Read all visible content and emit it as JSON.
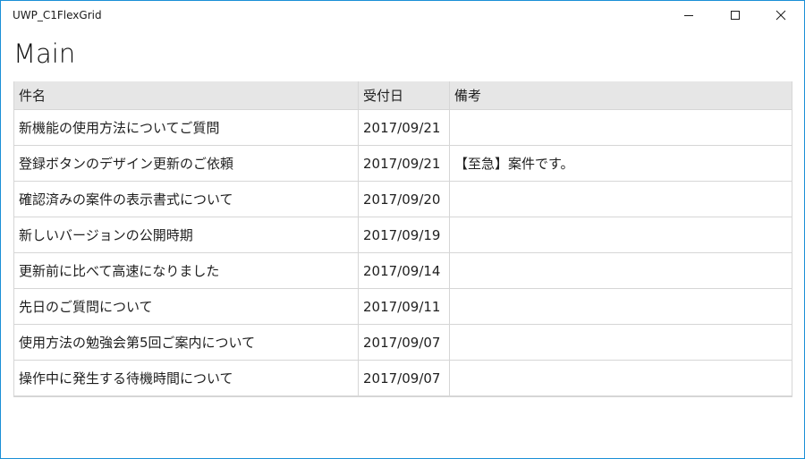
{
  "window": {
    "title": "UWP_C1FlexGrid",
    "accent": "#1a8fd6"
  },
  "caption_buttons": {
    "minimize_icon": "minimize-icon",
    "maximize_icon": "maximize-icon",
    "close_icon": "close-icon"
  },
  "page": {
    "title": "Main"
  },
  "grid": {
    "columns": [
      "件名",
      "受付日",
      "備考"
    ],
    "rows": [
      {
        "subject": "新機能の使用方法についてご質問",
        "date": "2017/09/21",
        "note": ""
      },
      {
        "subject": "登録ボタンのデザイン更新のご依頼",
        "date": "2017/09/21",
        "note": "【至急】案件です。"
      },
      {
        "subject": "確認済みの案件の表示書式について",
        "date": "2017/09/20",
        "note": ""
      },
      {
        "subject": "新しいバージョンの公開時期",
        "date": "2017/09/19",
        "note": ""
      },
      {
        "subject": "更新前に比べて高速になりました",
        "date": "2017/09/14",
        "note": ""
      },
      {
        "subject": "先日のご質問について",
        "date": "2017/09/11",
        "note": ""
      },
      {
        "subject": "使用方法の勉強会第5回ご案内について",
        "date": "2017/09/07",
        "note": ""
      },
      {
        "subject": "操作中に発生する待機時間について",
        "date": "2017/09/07",
        "note": ""
      }
    ]
  }
}
